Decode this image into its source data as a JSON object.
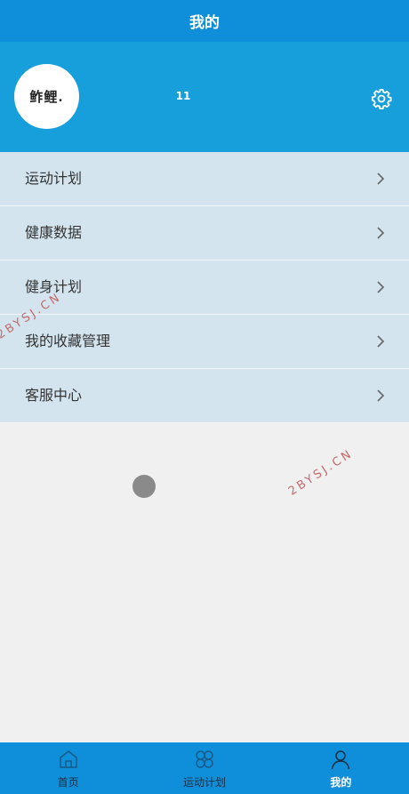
{
  "header": {
    "title": "我的"
  },
  "profile": {
    "avatar_text": "鲊鲤.",
    "username": "11",
    "settings_icon": "gear-icon"
  },
  "menu": {
    "items": [
      {
        "label": "运动计划"
      },
      {
        "label": "健康数据"
      },
      {
        "label": "健身计划"
      },
      {
        "label": "我的收藏管理"
      },
      {
        "label": "客服中心"
      }
    ]
  },
  "watermark": {
    "text": "2BYSJ.CN"
  },
  "tabbar": {
    "items": [
      {
        "label": "首页",
        "icon": "home-icon",
        "active": false
      },
      {
        "label": "运动计划",
        "icon": "clover-icon",
        "active": false
      },
      {
        "label": "我的",
        "icon": "person-icon",
        "active": true
      }
    ]
  },
  "colors": {
    "primary": "#0f8fd9",
    "profile_bg": "#179fdc",
    "menu_bg": "#d3e4ee",
    "page_bg": "#f0f0f0",
    "watermark": "#c46a6a"
  }
}
